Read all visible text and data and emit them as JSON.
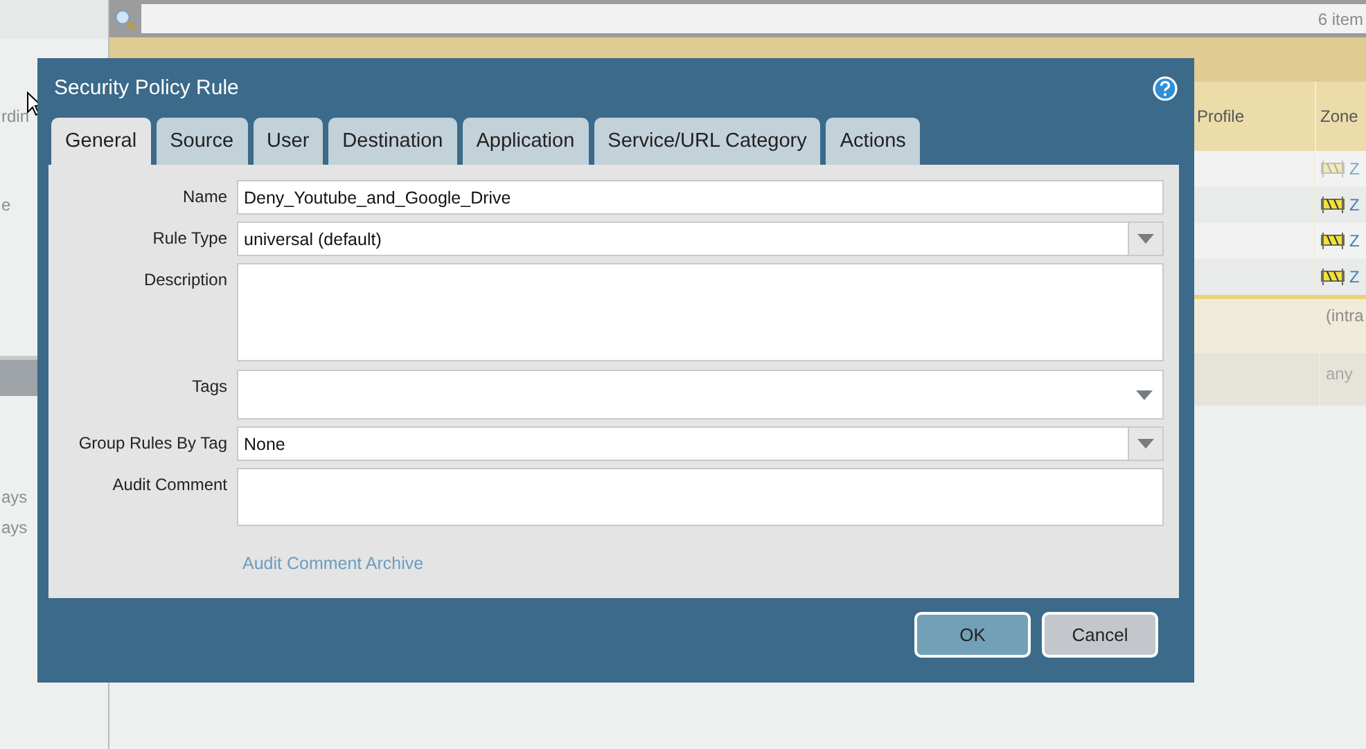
{
  "background": {
    "sidebar_texts": [
      "rdin",
      "e",
      "ays",
      "ays"
    ],
    "item_count": "6 item",
    "columns": [
      "Profile",
      "Zone"
    ],
    "zone_rows": [
      {
        "text": "Z",
        "disabled": true
      },
      {
        "text": "Z",
        "disabled": false
      },
      {
        "text": "Z",
        "disabled": false
      },
      {
        "text": "Z",
        "disabled": false
      }
    ],
    "extra_rows": [
      "(intra",
      "any"
    ]
  },
  "dialog": {
    "title": "Security Policy Rule",
    "tabs": [
      {
        "label": "General",
        "selected": true
      },
      {
        "label": "Source",
        "selected": false
      },
      {
        "label": "User",
        "selected": false
      },
      {
        "label": "Destination",
        "selected": false
      },
      {
        "label": "Application",
        "selected": false
      },
      {
        "label": "Service/URL Category",
        "selected": false
      },
      {
        "label": "Actions",
        "selected": false
      }
    ],
    "fields": [
      {
        "label": "Name",
        "kind": "text",
        "value": "Deny_Youtube_and_Google_Drive"
      },
      {
        "label": "Rule Type",
        "kind": "select",
        "value": "universal (default)"
      },
      {
        "label": "Description",
        "kind": "textarea"
      },
      {
        "label": "Tags",
        "kind": "tags"
      },
      {
        "label": "Group Rules By Tag",
        "kind": "select",
        "value": "None"
      },
      {
        "label": "Audit Comment",
        "kind": "textarea"
      }
    ],
    "link": "Audit Comment Archive",
    "buttons": [
      {
        "label": "OK",
        "kind": "primary"
      },
      {
        "label": "Cancel",
        "kind": "secondary"
      }
    ]
  }
}
